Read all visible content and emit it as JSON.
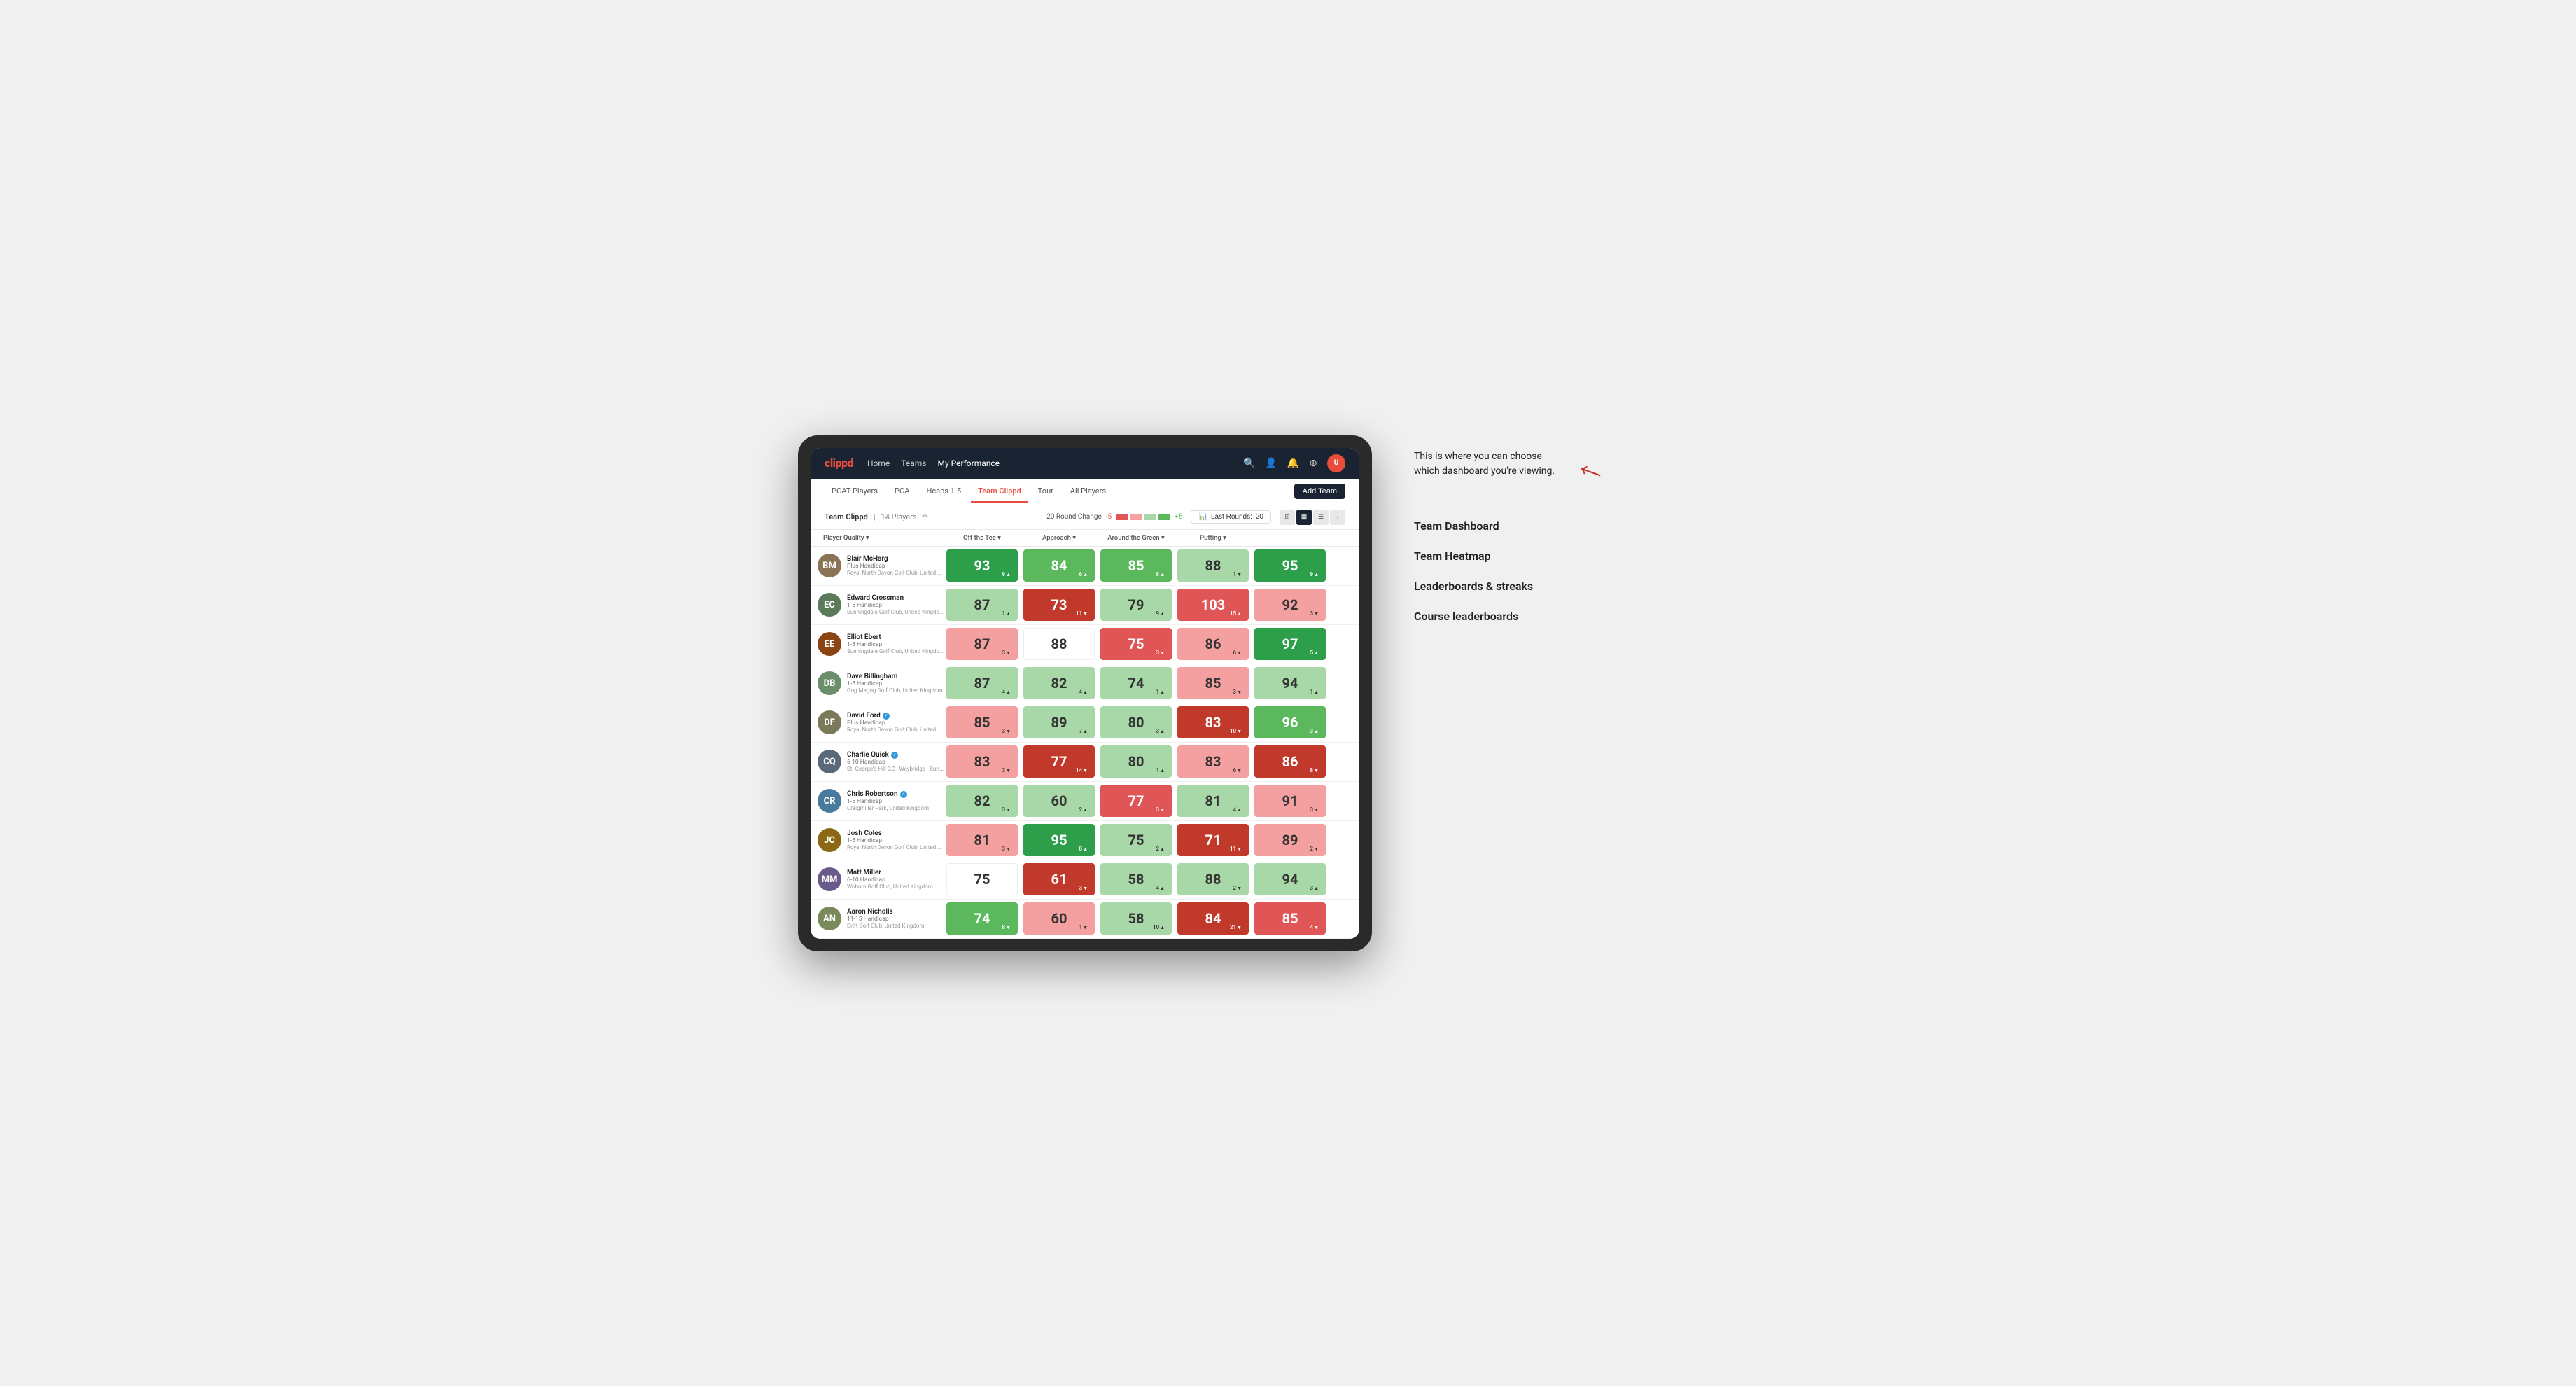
{
  "annotation": {
    "intro_text": "This is where you can choose which dashboard you're viewing.",
    "items": [
      "Team Dashboard",
      "Team Heatmap",
      "Leaderboards & streaks",
      "Course leaderboards"
    ]
  },
  "nav": {
    "logo": "clippd",
    "links": [
      "Home",
      "Teams",
      "My Performance"
    ],
    "active_link": "My Performance",
    "icons": [
      "🔍",
      "👤",
      "🔔",
      "⊕",
      "👤"
    ]
  },
  "sub_nav": {
    "links": [
      "PGAT Players",
      "PGA",
      "Hcaps 1-5",
      "Team Clippd",
      "Tour",
      "All Players"
    ],
    "active": "Team Clippd",
    "add_team_label": "Add Team"
  },
  "team_bar": {
    "name": "Team Clippd",
    "count": "14 Players",
    "round_change_label": "20 Round Change",
    "round_change_value_neg": "-5",
    "round_change_value_pos": "+5",
    "last_rounds_label": "Last Rounds:",
    "last_rounds_value": "20"
  },
  "column_headers": [
    "Player Quality ▾",
    "Off the Tee ▾",
    "Approach ▾",
    "Around the Green ▾",
    "Putting ▾"
  ],
  "players": [
    {
      "name": "Blair McHarg",
      "handicap": "Plus Handicap",
      "club": "Royal North Devon Golf Club, United Kingdom",
      "avatar_color": "#8B7355",
      "initials": "BM",
      "scores": [
        {
          "value": 93,
          "change": "+9",
          "dir": "up",
          "color": "bg-green-strong"
        },
        {
          "value": 84,
          "change": "6",
          "dir": "up",
          "color": "bg-green-mid"
        },
        {
          "value": 85,
          "change": "8",
          "dir": "up",
          "color": "bg-green-mid"
        },
        {
          "value": 88,
          "change": "-1",
          "dir": "down",
          "color": "bg-green-light"
        },
        {
          "value": 95,
          "change": "9",
          "dir": "up",
          "color": "bg-green-strong"
        }
      ]
    },
    {
      "name": "Edward Crossman",
      "handicap": "1-5 Handicap",
      "club": "Sunningdale Golf Club, United Kingdom",
      "avatar_color": "#5a7a5a",
      "initials": "EC",
      "scores": [
        {
          "value": 87,
          "change": "1",
          "dir": "up",
          "color": "bg-green-light"
        },
        {
          "value": 73,
          "change": "-11",
          "dir": "down",
          "color": "bg-red-strong"
        },
        {
          "value": 79,
          "change": "9",
          "dir": "up",
          "color": "bg-green-light"
        },
        {
          "value": 103,
          "change": "15",
          "dir": "up",
          "color": "bg-red-mid"
        },
        {
          "value": 92,
          "change": "-3",
          "dir": "down",
          "color": "bg-red-light"
        }
      ]
    },
    {
      "name": "Elliot Ebert",
      "handicap": "1-5 Handicap",
      "club": "Sunningdale Golf Club, United Kingdom",
      "avatar_color": "#8B4513",
      "initials": "EE",
      "scores": [
        {
          "value": 87,
          "change": "-3",
          "dir": "down",
          "color": "bg-red-light"
        },
        {
          "value": 88,
          "change": "",
          "dir": "",
          "color": "bg-white"
        },
        {
          "value": 75,
          "change": "-3",
          "dir": "down",
          "color": "bg-red-mid"
        },
        {
          "value": 86,
          "change": "-6",
          "dir": "down",
          "color": "bg-red-light"
        },
        {
          "value": 97,
          "change": "5",
          "dir": "up",
          "color": "bg-green-strong"
        }
      ]
    },
    {
      "name": "Dave Billingham",
      "handicap": "1-5 Handicap",
      "club": "Gog Magog Golf Club, United Kingdom",
      "avatar_color": "#6b8e6b",
      "initials": "DB",
      "scores": [
        {
          "value": 87,
          "change": "4",
          "dir": "up",
          "color": "bg-green-light"
        },
        {
          "value": 82,
          "change": "4",
          "dir": "up",
          "color": "bg-green-light"
        },
        {
          "value": 74,
          "change": "1",
          "dir": "up",
          "color": "bg-green-light"
        },
        {
          "value": 85,
          "change": "-3",
          "dir": "down",
          "color": "bg-red-light"
        },
        {
          "value": 94,
          "change": "1",
          "dir": "up",
          "color": "bg-green-light"
        }
      ]
    },
    {
      "name": "David Ford",
      "handicap": "Plus Handicap",
      "club": "Royal North Devon Golf Club, United Kingdom",
      "avatar_color": "#7a7a5a",
      "initials": "DF",
      "verified": true,
      "scores": [
        {
          "value": 85,
          "change": "-3",
          "dir": "down",
          "color": "bg-red-light"
        },
        {
          "value": 89,
          "change": "7",
          "dir": "up",
          "color": "bg-green-light"
        },
        {
          "value": 80,
          "change": "3",
          "dir": "up",
          "color": "bg-green-light"
        },
        {
          "value": 83,
          "change": "-10",
          "dir": "down",
          "color": "bg-red-strong"
        },
        {
          "value": 96,
          "change": "3",
          "dir": "up",
          "color": "bg-green-mid"
        }
      ]
    },
    {
      "name": "Charlie Quick",
      "handicap": "6-10 Handicap",
      "club": "St. George's Hill GC - Weybridge - Surrey, Uni...",
      "avatar_color": "#5a6a7a",
      "initials": "CQ",
      "verified": true,
      "scores": [
        {
          "value": 83,
          "change": "-3",
          "dir": "down",
          "color": "bg-red-light"
        },
        {
          "value": 77,
          "change": "-14",
          "dir": "down",
          "color": "bg-red-strong"
        },
        {
          "value": 80,
          "change": "1",
          "dir": "up",
          "color": "bg-green-light"
        },
        {
          "value": 83,
          "change": "-6",
          "dir": "down",
          "color": "bg-red-light"
        },
        {
          "value": 86,
          "change": "-8",
          "dir": "down",
          "color": "bg-red-strong"
        }
      ]
    },
    {
      "name": "Chris Robertson",
      "handicap": "1-5 Handicap",
      "club": "Craigmillar Park, United Kingdom",
      "avatar_color": "#4a7a9b",
      "initials": "CR",
      "verified": true,
      "scores": [
        {
          "value": 82,
          "change": "-3",
          "dir": "down",
          "color": "bg-green-light"
        },
        {
          "value": 60,
          "change": "2",
          "dir": "up",
          "color": "bg-green-light"
        },
        {
          "value": 77,
          "change": "-3",
          "dir": "down",
          "color": "bg-red-mid"
        },
        {
          "value": 81,
          "change": "4",
          "dir": "up",
          "color": "bg-green-light"
        },
        {
          "value": 91,
          "change": "-3",
          "dir": "down",
          "color": "bg-red-light"
        }
      ]
    },
    {
      "name": "Josh Coles",
      "handicap": "1-5 Handicap",
      "club": "Royal North Devon Golf Club, United Kingdom",
      "avatar_color": "#8B6914",
      "initials": "JC",
      "scores": [
        {
          "value": 81,
          "change": "-3",
          "dir": "down",
          "color": "bg-red-light"
        },
        {
          "value": 95,
          "change": "8",
          "dir": "up",
          "color": "bg-green-strong"
        },
        {
          "value": 75,
          "change": "2",
          "dir": "up",
          "color": "bg-green-light"
        },
        {
          "value": 71,
          "change": "-11",
          "dir": "down",
          "color": "bg-red-strong"
        },
        {
          "value": 89,
          "change": "-2",
          "dir": "down",
          "color": "bg-red-light"
        }
      ]
    },
    {
      "name": "Matt Miller",
      "handicap": "6-10 Handicap",
      "club": "Woburn Golf Club, United Kingdom",
      "avatar_color": "#6a5a8a",
      "initials": "MM",
      "scores": [
        {
          "value": 75,
          "change": "",
          "dir": "",
          "color": "bg-white"
        },
        {
          "value": 61,
          "change": "-3",
          "dir": "down",
          "color": "bg-red-strong"
        },
        {
          "value": 58,
          "change": "4",
          "dir": "up",
          "color": "bg-green-light"
        },
        {
          "value": 88,
          "change": "-2",
          "dir": "down",
          "color": "bg-green-light"
        },
        {
          "value": 94,
          "change": "3",
          "dir": "up",
          "color": "bg-green-light"
        }
      ]
    },
    {
      "name": "Aaron Nicholls",
      "handicap": "11-15 Handicap",
      "club": "Drift Golf Club, United Kingdom",
      "avatar_color": "#7a8a5a",
      "initials": "AN",
      "scores": [
        {
          "value": 74,
          "change": "-8",
          "dir": "down",
          "color": "bg-green-mid"
        },
        {
          "value": 60,
          "change": "-1",
          "dir": "down",
          "color": "bg-red-light"
        },
        {
          "value": 58,
          "change": "10",
          "dir": "up",
          "color": "bg-green-light"
        },
        {
          "value": 84,
          "change": "-21",
          "dir": "down",
          "color": "bg-red-strong"
        },
        {
          "value": 85,
          "change": "-4",
          "dir": "down",
          "color": "bg-red-mid"
        }
      ]
    }
  ]
}
